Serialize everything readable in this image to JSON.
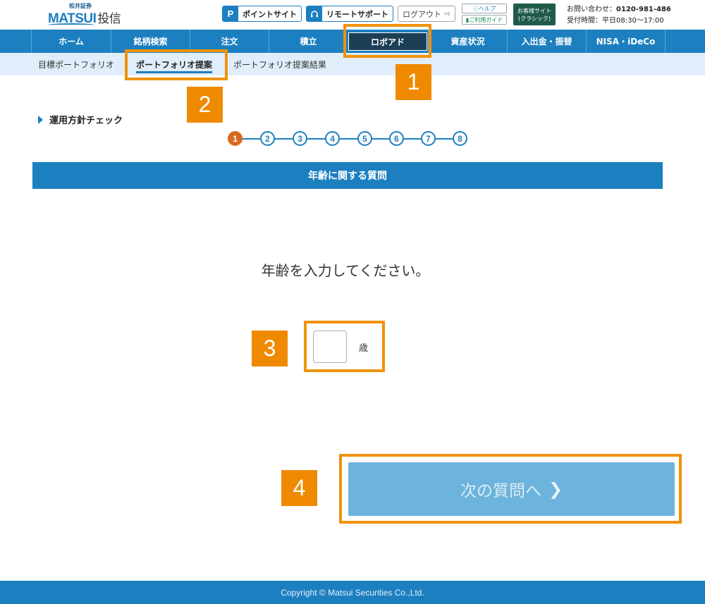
{
  "header": {
    "logo_sub": "松井証券",
    "logo_main": "MATSUI",
    "logo_kanji": "投信",
    "point_badge": "P",
    "point_label": "ポイントサイト",
    "remote_label": "リモートサポート",
    "logout_label": "ログアウト",
    "help_label": "ヘルプ",
    "guide_label": "ご利用ガイド",
    "classic_line1": "お客様サイト",
    "classic_line2": "(クラシック)",
    "contact_prefix": "お問い合わせ：",
    "contact_phone": "0120-981-486",
    "contact_hours": "受付時間：平日08:30～17:00"
  },
  "nav": {
    "items": [
      "ホーム",
      "銘柄検索",
      "注文",
      "積立",
      "ロボアド",
      "資産状況",
      "入出金・振替",
      "NISA・iDeCo"
    ],
    "active_index": 4
  },
  "subnav": {
    "items": [
      "目標ポートフォリオ",
      "ポートフォリオ提案",
      "ポートフォリオ提案結果"
    ],
    "active_index": 1
  },
  "callouts": [
    "1",
    "2",
    "3",
    "4"
  ],
  "content": {
    "section_label": "運用方針チェック",
    "steps": [
      "1",
      "2",
      "3",
      "4",
      "5",
      "6",
      "7",
      "8"
    ],
    "current_step": 1,
    "question_title": "年齢に関する質問",
    "prompt": "年齢を入力してください。",
    "age_value": "",
    "age_unit": "歳",
    "next_label": "次の質問へ"
  },
  "footer": {
    "copyright": "Copyright © Matsui Securities Co.,Ltd."
  },
  "colors": {
    "primary": "#1c7fc0",
    "active_nav": "#1c3f55",
    "subnav_bg": "#dfeefa",
    "callout": "#ef8a00",
    "current_step": "#d9691f",
    "next_button_disabled": "#6cb4dd"
  }
}
